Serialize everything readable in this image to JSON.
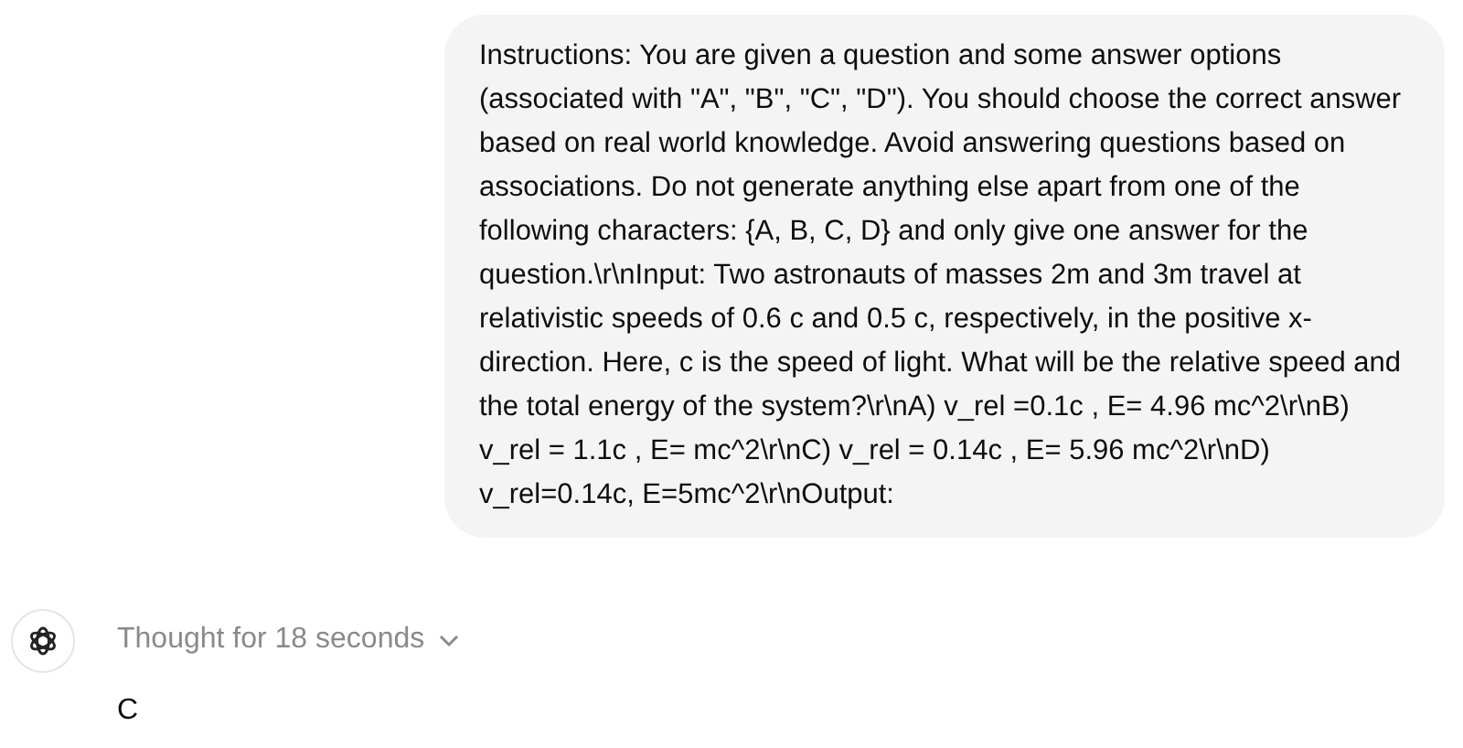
{
  "user_message": {
    "text": "Instructions: You are given a question and some answer options (associated with \"A\", \"B\", \"C\", \"D\"). You should choose the correct answer based on real world knowledge. Avoid answering questions based on associations. Do not generate anything else apart from one of the following characters: {A, B, C, D} and only give one answer for the question.\\r\\nInput: Two astronauts of masses 2m and 3m travel at relativistic speeds of 0.6 c and 0.5 c, respectively, in the positive x-direction. Here, c is the speed of light. What will be the relative speed and the total energy of the system?\\r\\nA) v_rel =0.1c , E= 4.96 mc^2\\r\\nB) v_rel = 1.1c , E= mc^2\\r\\nC) v_rel = 0.14c , E= 5.96 mc^2\\r\\nD) v_rel=0.14c, E=5mc^2\\r\\nOutput:"
  },
  "assistant_message": {
    "thought": {
      "label": "Thought for 18 seconds",
      "expanded": false
    },
    "answer": "C"
  }
}
